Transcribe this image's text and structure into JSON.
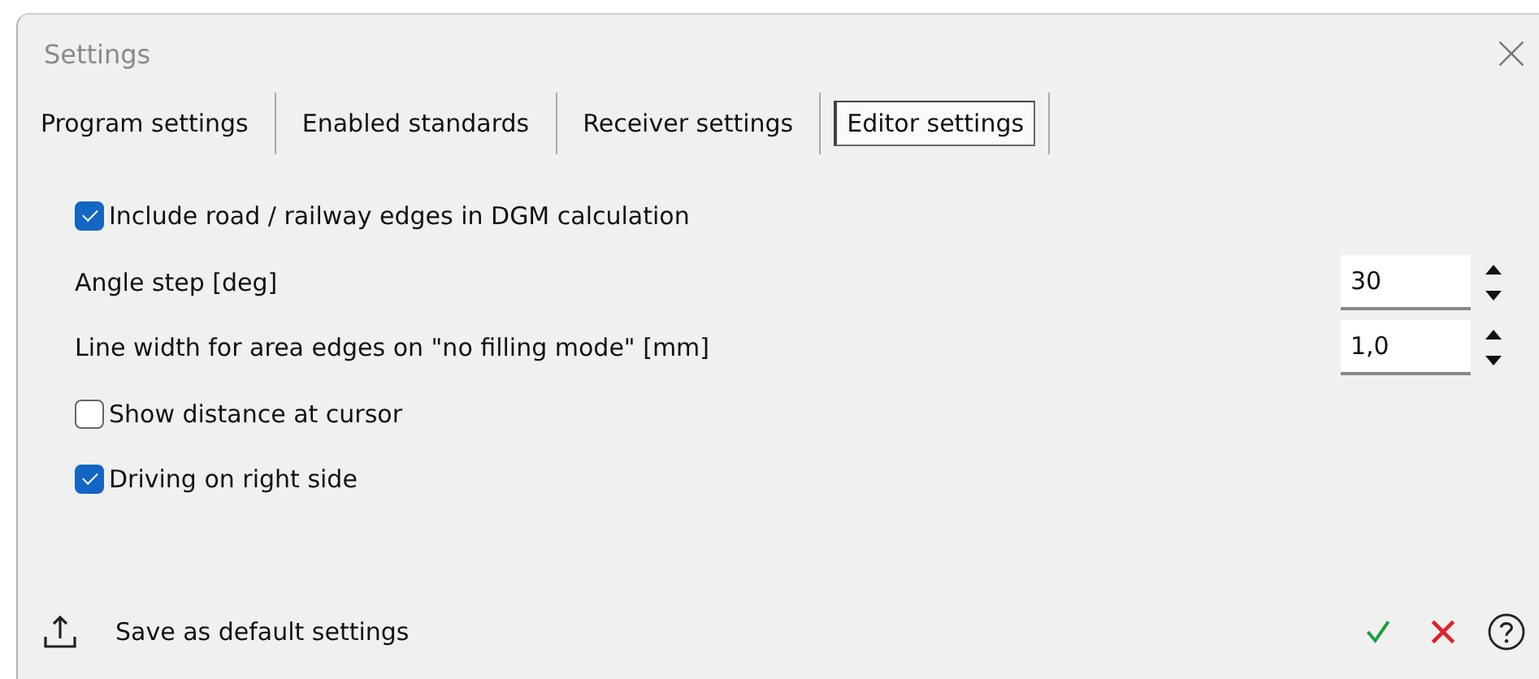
{
  "window": {
    "title": "Settings"
  },
  "tabs": [
    {
      "label": "Program settings",
      "selected": false
    },
    {
      "label": "Enabled standards",
      "selected": false
    },
    {
      "label": "Receiver settings",
      "selected": false
    },
    {
      "label": "Editor settings",
      "selected": true
    }
  ],
  "settings": [
    {
      "kind": "checkbox",
      "label": "Include road / railway edges in DGM calculation",
      "checked": true
    },
    {
      "kind": "spinner",
      "label": "Angle step [deg]",
      "value": "30"
    },
    {
      "kind": "spinner",
      "label": "Line width for area edges on \"no filling mode\" [mm]",
      "value": "1,0"
    },
    {
      "kind": "checkbox",
      "label": "Show distance at cursor",
      "checked": false
    },
    {
      "kind": "checkbox",
      "label": "Driving on right side",
      "checked": true
    }
  ],
  "footer": {
    "save_label": "Save as default settings"
  }
}
